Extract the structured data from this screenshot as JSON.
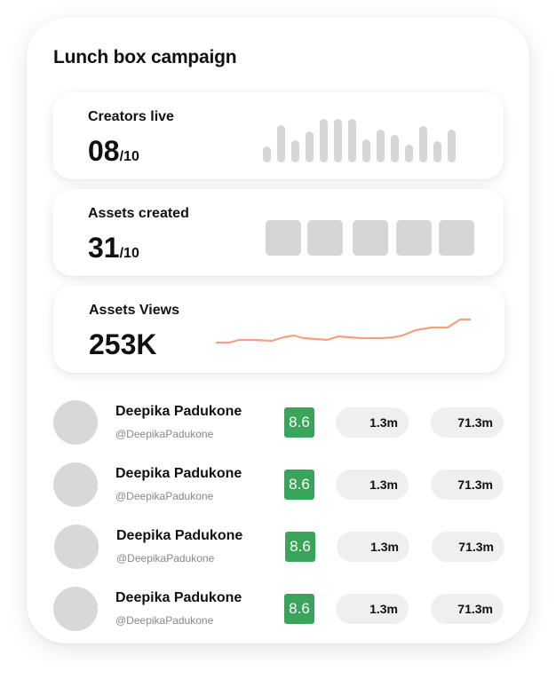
{
  "campaign": {
    "title": "Lunch box campaign"
  },
  "metrics": {
    "creators": {
      "label": "Creators live",
      "value": "08",
      "total": "/10"
    },
    "assets_created": {
      "label": "Assets created",
      "value": "31",
      "total": "/10"
    },
    "assets_views": {
      "label": "Assets Views",
      "value": "253K"
    }
  },
  "creators": [
    {
      "name": "Deepika Padukone",
      "handle": "@DeepikaPadukone",
      "score": "8.6",
      "stat1": "1.3m",
      "stat2": "71.3m"
    },
    {
      "name": "Deepika Padukone",
      "handle": "@DeepikaPadukone",
      "score": "8.6",
      "stat1": "1.3m",
      "stat2": "71.3m"
    },
    {
      "name": "Deepika Padukone",
      "handle": "@DeepikaPadukone",
      "score": "8.6",
      "stat1": "1.3m",
      "stat2": "71.3m"
    },
    {
      "name": "Deepika Padukone",
      "handle": "@DeepikaPadukone",
      "score": "8.6",
      "stat1": "1.3m",
      "stat2": "71.3m"
    }
  ],
  "colors": {
    "score_green": "#3aa45a",
    "sparkline": "#f5a07e",
    "placeholder_gray": "#d6d6d6",
    "pill_bg": "#efefef"
  }
}
